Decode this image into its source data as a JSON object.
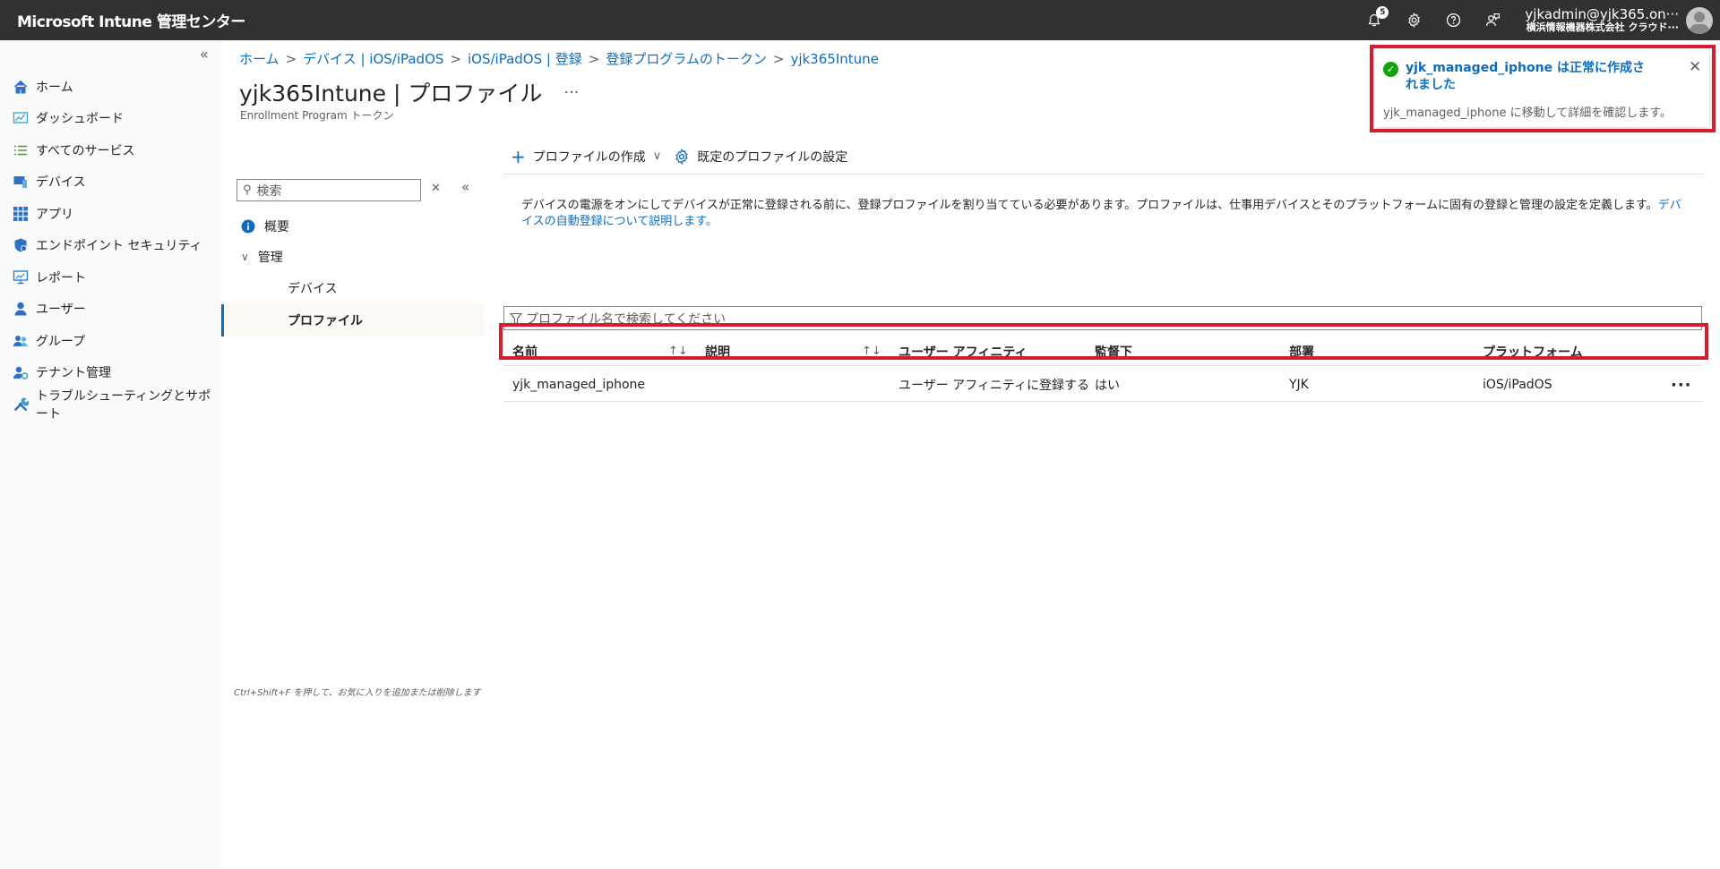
{
  "topbar": {
    "brand": "Microsoft Intune 管理センター",
    "notification_count": "5",
    "account_name": "yjkadmin@yjk365.on···",
    "account_org": "横浜情報機器株式会社 クラウド···"
  },
  "leftnav": {
    "items": [
      {
        "label": "ホーム",
        "icon": "home-icon"
      },
      {
        "label": "ダッシュボード",
        "icon": "dashboard-icon"
      },
      {
        "label": "すべてのサービス",
        "icon": "list-icon"
      },
      {
        "label": "デバイス",
        "icon": "devices-icon"
      },
      {
        "label": "アプリ",
        "icon": "apps-grid-icon"
      },
      {
        "label": "エンドポイント セキュリティ",
        "icon": "shield-icon"
      },
      {
        "label": "レポート",
        "icon": "reports-icon"
      },
      {
        "label": "ユーザー",
        "icon": "user-icon"
      },
      {
        "label": "グループ",
        "icon": "group-icon"
      },
      {
        "label": "テナント管理",
        "icon": "tenant-icon"
      },
      {
        "label": "トラブルシューティングとサポート",
        "icon": "wrench-icon"
      }
    ]
  },
  "breadcrumb": [
    "ホーム",
    "デバイス | iOS/iPadOS",
    "iOS/iPadOS | 登録",
    "登録プログラムのトークン",
    "yjk365Intune"
  ],
  "page": {
    "title": "yjk365Intune | プロファイル",
    "more": "···",
    "subtitle": "Enrollment Program トークン"
  },
  "inner_menu": {
    "search_placeholder": "検索",
    "overview": "概要",
    "manage": "管理",
    "devices": "デバイス",
    "profiles": "プロファイル",
    "footer_hint": "Ctrl+Shift+F を押して、お気に入りを追加または削除します"
  },
  "toolbar": {
    "create_profile": "プロファイルの作成",
    "default_profile": "既定のプロファイルの設定"
  },
  "info": {
    "text": "デバイスの電源をオンにしてデバイスが正常に登録される前に、登録プロファイルを割り当てている必要があります。プロファイルは、仕事用デバイスとそのプラットフォームに固有の登録と管理の設定を定義します。",
    "link": "デバイスの自動登録について説明します。"
  },
  "filter": {
    "placeholder": "プロファイル名で検索してください"
  },
  "table": {
    "headers": [
      "名前",
      "説明",
      "ユーザー アフィニティ",
      "監督下",
      "部署",
      "プラットフォーム"
    ],
    "rows": [
      {
        "name": "yjk_managed_iphone",
        "description": "",
        "affinity": "ユーザー アフィニティに登録する",
        "supervised": "はい",
        "department": "YJK",
        "platform": "iOS/iPadOS"
      }
    ]
  },
  "toast": {
    "title": "yjk_managed_iphone は正常に作成されました",
    "body": "yjk_managed_iphone に移動して詳細を確認します。"
  }
}
